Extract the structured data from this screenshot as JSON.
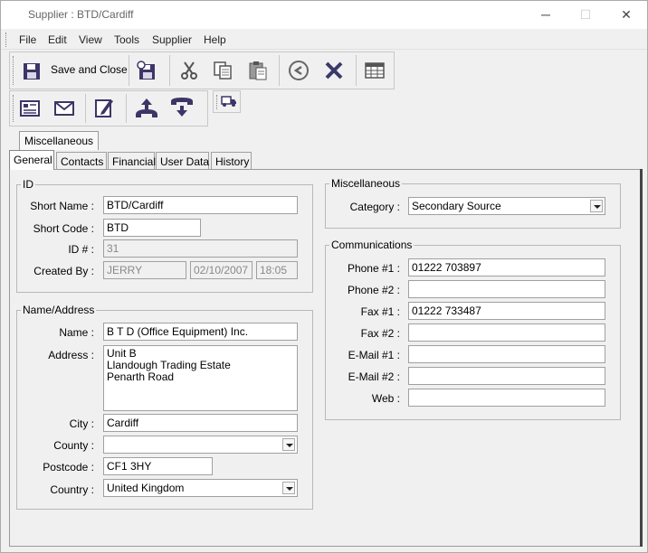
{
  "window": {
    "title": "Supplier : BTD/Cardiff",
    "minimize": "─",
    "maximize": "☐",
    "close": "✕"
  },
  "menu": [
    "File",
    "Edit",
    "View",
    "Tools",
    "Supplier",
    "Help"
  ],
  "toolbar": {
    "save_close_label": "Save and Close",
    "icons": [
      "save-icon",
      "save-new-icon",
      "cut-icon",
      "copy-icon",
      "paste-icon",
      "undo-icon",
      "delete-icon",
      "grid-icon",
      "card-icon",
      "mail-icon",
      "edit-icon",
      "call-up-icon",
      "hangup-icon",
      "truck-icon"
    ]
  },
  "upper_tab": "Miscellaneous",
  "tabs": [
    "General",
    "Contacts",
    "Financial",
    "User Data",
    "History"
  ],
  "id_group": {
    "legend": "ID",
    "short_name_label": "Short Name :",
    "short_name": "BTD/Cardiff",
    "short_code_label": "Short Code :",
    "short_code": "BTD",
    "id_label": "ID # :",
    "id_value": "31",
    "created_by_label": "Created By :",
    "created_by": "JERRY",
    "created_date": "02/10/2007",
    "created_time": "18:05"
  },
  "address_group": {
    "legend": "Name/Address",
    "name_label": "Name :",
    "name": "B T D (Office Equipment) Inc.",
    "address_label": "Address :",
    "address": "Unit B\nLlandough Trading Estate\nPenarth Road",
    "city_label": "City :",
    "city": "Cardiff",
    "county_label": "County :",
    "county": "",
    "postcode_label": "Postcode :",
    "postcode": "CF1 3HY",
    "country_label": "Country :",
    "country": "United Kingdom"
  },
  "misc_group": {
    "legend": "Miscellaneous",
    "category_label": "Category :",
    "category": "Secondary Source"
  },
  "comm_group": {
    "legend": "Communications",
    "phone1_label": "Phone #1 :",
    "phone1": "01222 703897",
    "phone2_label": "Phone #2 :",
    "phone2": "",
    "fax1_label": "Fax #1 :",
    "fax1": "01222 733487",
    "fax2_label": "Fax #2 :",
    "fax2": "",
    "email1_label": "E-Mail #1 :",
    "email1": "",
    "email2_label": "E-Mail #2 :",
    "email2": "",
    "web_label": "Web :",
    "web": ""
  },
  "colors": {
    "icon": "#3d3566",
    "delete": "#3a3a6a"
  }
}
